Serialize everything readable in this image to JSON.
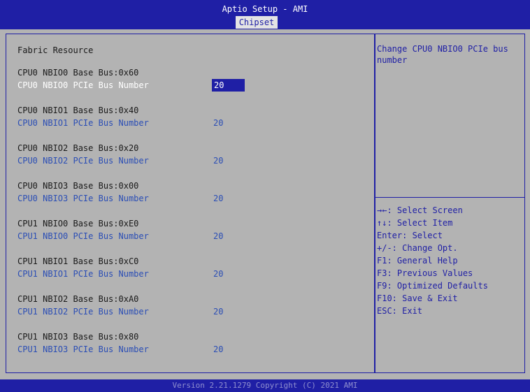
{
  "header": {
    "title": "Aptio Setup - AMI",
    "tab": "Chipset"
  },
  "section_title": "Fabric Resource",
  "items": [
    {
      "base": "CPU0 NBIO0 Base Bus:0x60",
      "label": "CPU0 NBIO0 PCIe Bus Number",
      "value": "20"
    },
    {
      "base": "CPU0 NBIO1 Base Bus:0x40",
      "label": "CPU0 NBIO1 PCIe Bus Number",
      "value": "20"
    },
    {
      "base": "CPU0 NBIO2 Base Bus:0x20",
      "label": "CPU0 NBIO2 PCIe Bus Number",
      "value": "20"
    },
    {
      "base": "CPU0 NBIO3 Base Bus:0x00",
      "label": "CPU0 NBIO3 PCIe Bus Number",
      "value": "20"
    },
    {
      "base": "CPU1 NBIO0 Base Bus:0xE0",
      "label": "CPU1 NBIO0 PCIe Bus Number",
      "value": "20"
    },
    {
      "base": "CPU1 NBIO1 Base Bus:0xC0",
      "label": "CPU1 NBIO1 PCIe Bus Number",
      "value": "20"
    },
    {
      "base": "CPU1 NBIO2 Base Bus:0xA0",
      "label": "CPU1 NBIO2 PCIe Bus Number",
      "value": "20"
    },
    {
      "base": "CPU1 NBIO3 Base Bus:0x80",
      "label": "CPU1 NBIO3 PCIe Bus Number",
      "value": "20"
    }
  ],
  "help": {
    "text": "Change CPU0 NBIO0 PCIe bus number"
  },
  "keys": [
    "→←: Select Screen",
    "↑↓: Select Item",
    "Enter: Select",
    "+/-: Change Opt.",
    "F1: General Help",
    "F3: Previous Values",
    "F9: Optimized Defaults",
    "F10: Save & Exit",
    "ESC: Exit"
  ],
  "footer": "Version 2.21.1279 Copyright (C) 2021 AMI",
  "colors": {
    "header_bg": "#1f1fa5",
    "content_bg": "#b3b3b3",
    "link_text": "#2b4eb5",
    "highlight_bg": "#1f1fa5"
  }
}
